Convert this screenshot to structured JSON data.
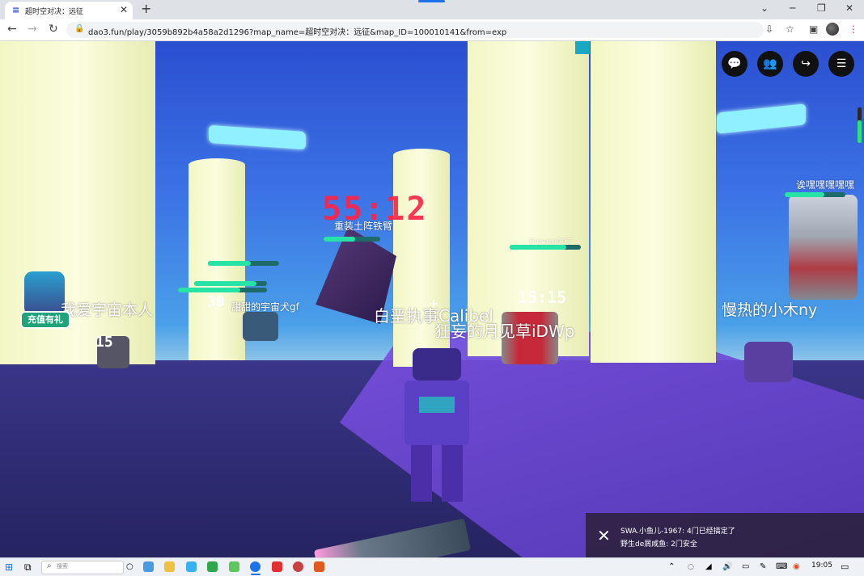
{
  "browser": {
    "tab_title": "超时空对决：远征",
    "tab_favicon": "document-icon",
    "url": "dao3.fun/play/3059b892b4a58a2d1296?map_name=超时空对决：远征&map_ID=100010141&from=exp",
    "new_tab_label": "+",
    "close_tab_label": "✕"
  },
  "game": {
    "timer": "55:12",
    "countdowns": [
      "15",
      "30",
      "15:15"
    ],
    "player_names": [
      "我爱宇宙本人",
      "甜甜的宇宙犬gf",
      "重装土阵铁臂",
      "白垩执事Calibel",
      "狂妄的月见草iDWp",
      "慢热的小木ny",
      "诶嘿嘿嘿嘿嘿",
      "Eleven007"
    ],
    "gift_label": "充值有礼",
    "top_buttons": [
      "chat-icon",
      "friends-icon",
      "share-icon",
      "menu-icon"
    ],
    "hp": [
      0.6,
      0.7,
      0.55,
      0.8,
      0.65,
      0.85
    ],
    "energy_level": 0.64,
    "notifications": [
      "SWA.小鱼儿-1967: 4门已经搞定了",
      "野生de屑咸鱼: 2门安全"
    ]
  },
  "taskbar": {
    "search_placeholder": "搜索",
    "clock": "19:05"
  },
  "colors": {
    "hp_fill": "#27e3a6",
    "timer": "#ff2244",
    "sky": "#3c73e6",
    "pillar": "#f8fbd4"
  }
}
